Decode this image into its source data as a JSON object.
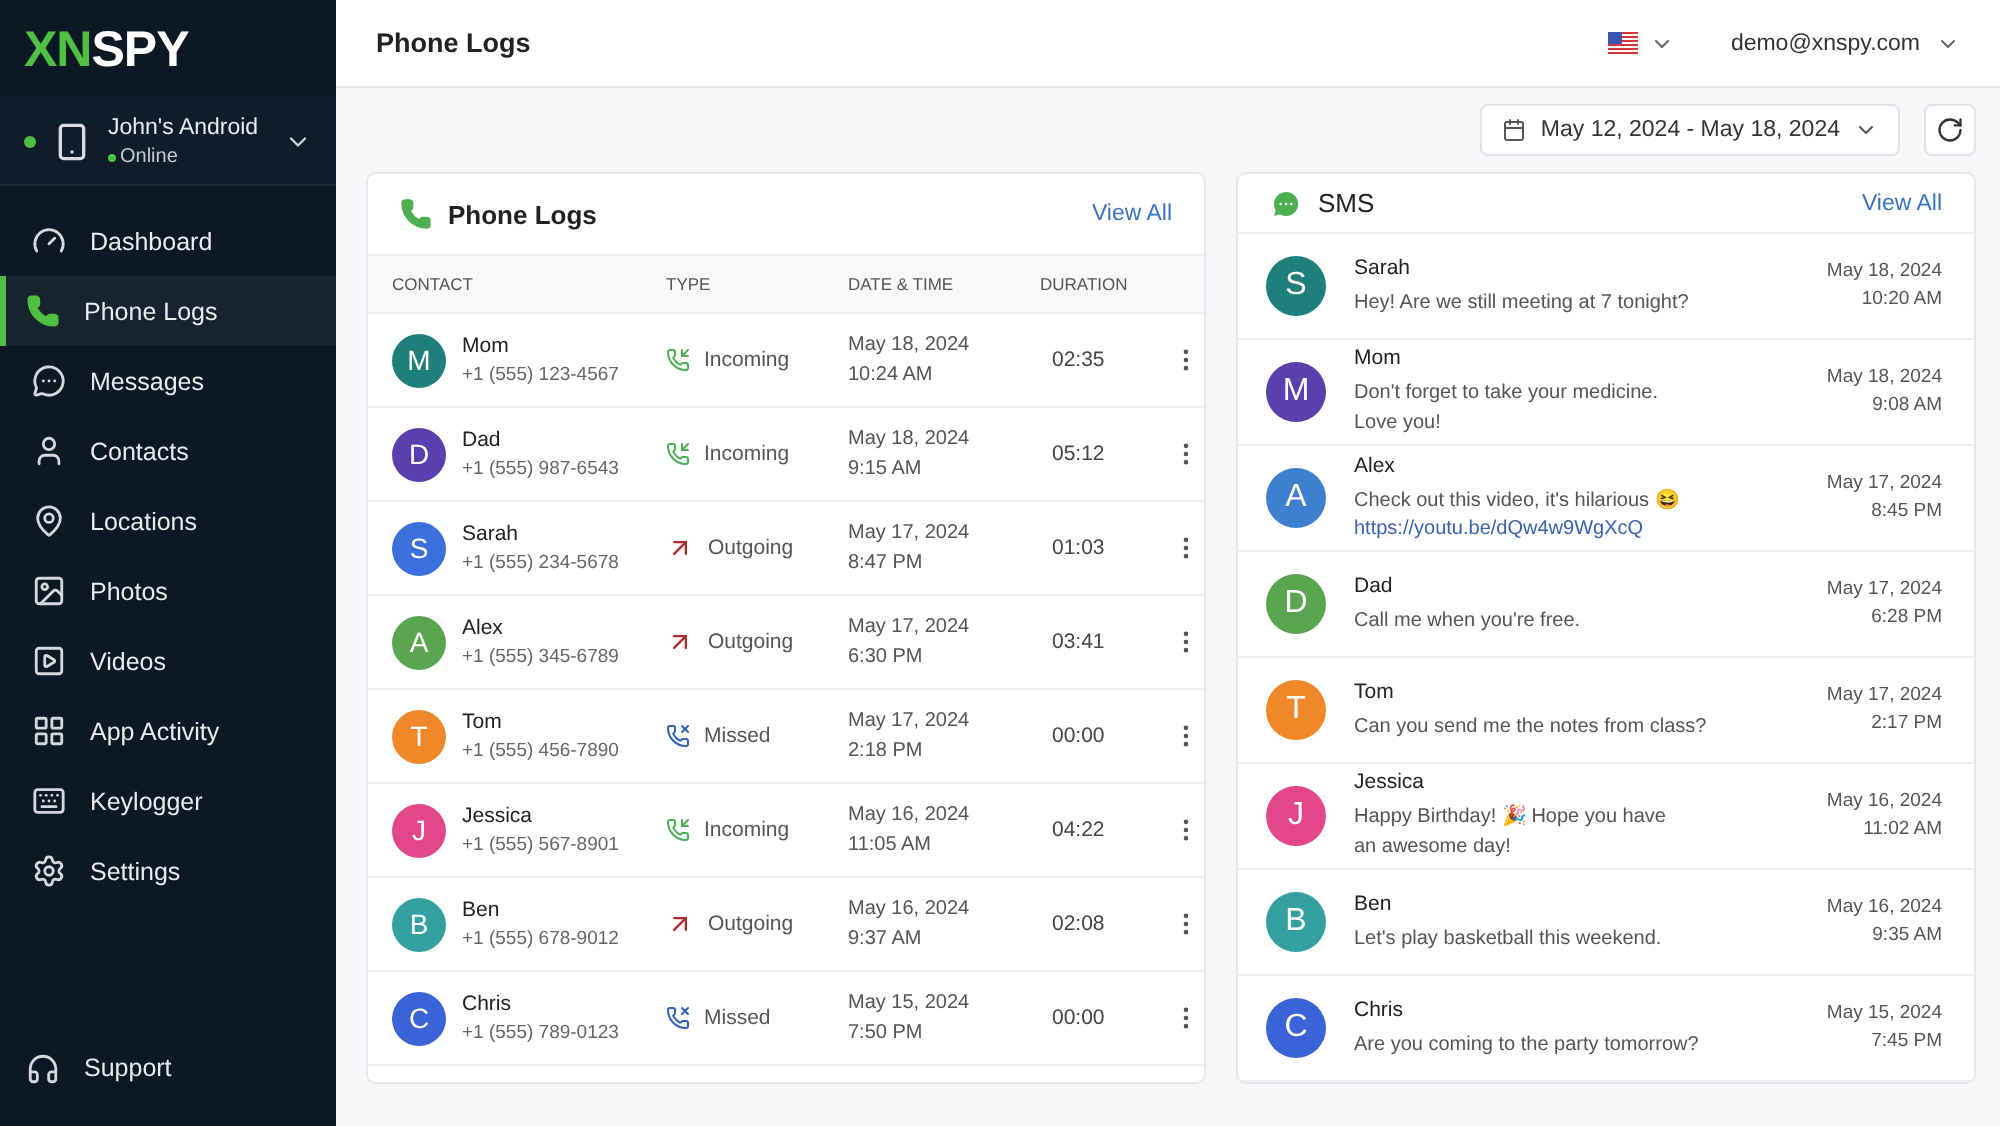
{
  "logo": {
    "accent": "XN",
    "rest": "SPY"
  },
  "device": {
    "name": "John's Android",
    "status": "Online",
    "online": true
  },
  "sidebar": {
    "items": [
      {
        "label": "Dashboard",
        "selected": false
      },
      {
        "label": "Phone Logs",
        "selected": true
      },
      {
        "label": "Messages",
        "selected": false
      },
      {
        "label": "Contacts",
        "selected": false
      },
      {
        "label": "Locations",
        "selected": false
      },
      {
        "label": "Photos",
        "selected": false
      },
      {
        "label": "Videos",
        "selected": false
      },
      {
        "label": "App Activity",
        "selected": false
      },
      {
        "label": "Keylogger",
        "selected": false
      },
      {
        "label": "Settings",
        "selected": false
      }
    ],
    "support": "Support"
  },
  "header": {
    "title": "Phone Logs",
    "account": "demo@xnspy.com"
  },
  "date_range": "May 12, 2024 - May 18, 2024",
  "phone_logs": {
    "title": "Phone Logs",
    "view_all": "View All",
    "columns": [
      "CONTACT",
      "TYPE",
      "DATE & TIME",
      "DURATION"
    ],
    "rows": [
      {
        "initial": "M",
        "color": "#1f7f7a",
        "name": "Mom",
        "phone": "+1 (555) 123-4567",
        "kind": "incoming",
        "type": "Incoming",
        "date": "May 18, 2024",
        "time": "10:24 AM",
        "duration": "02:35"
      },
      {
        "initial": "D",
        "color": "#5b3fae",
        "name": "Dad",
        "phone": "+1 (555) 987-6543",
        "kind": "incoming",
        "type": "Incoming",
        "date": "May 18, 2024",
        "time": "9:15 AM",
        "duration": "05:12"
      },
      {
        "initial": "S",
        "color": "#3a6fdc",
        "name": "Sarah",
        "phone": "+1 (555) 234-5678",
        "kind": "outgoing",
        "type": "Outgoing",
        "date": "May 17, 2024",
        "time": "8:47 PM",
        "duration": "01:03"
      },
      {
        "initial": "A",
        "color": "#5aa650",
        "name": "Alex",
        "phone": "+1 (555) 345-6789",
        "kind": "outgoing",
        "type": "Outgoing",
        "date": "May 17, 2024",
        "time": "6:30 PM",
        "duration": "03:41"
      },
      {
        "initial": "T",
        "color": "#f0882a",
        "name": "Tom",
        "phone": "+1 (555) 456-7890",
        "kind": "missed",
        "type": "Missed",
        "date": "May 17, 2024",
        "time": "2:18 PM",
        "duration": "00:00"
      },
      {
        "initial": "J",
        "color": "#e2478a",
        "name": "Jessica",
        "phone": "+1 (555) 567-8901",
        "kind": "incoming",
        "type": "Incoming",
        "date": "May 16, 2024",
        "time": "11:05 AM",
        "duration": "04:22"
      },
      {
        "initial": "B",
        "color": "#35a0a0",
        "name": "Ben",
        "phone": "+1 (555) 678-9012",
        "kind": "outgoing",
        "type": "Outgoing",
        "date": "May 16, 2024",
        "time": "9:37 AM",
        "duration": "02:08"
      },
      {
        "initial": "C",
        "color": "#3a63d8",
        "name": "Chris",
        "phone": "+1 (555) 789-0123",
        "kind": "missed",
        "type": "Missed",
        "date": "May 15, 2024",
        "time": "7:50 PM",
        "duration": "00:00"
      }
    ]
  },
  "sms": {
    "title": "SMS",
    "view_all": "View All",
    "rows": [
      {
        "initial": "S",
        "color": "#1f7f7a",
        "name": "Sarah",
        "message": "Hey! Are we still meeting at 7 tonight?",
        "date": "May 18, 2024",
        "time": "10:20 AM"
      },
      {
        "initial": "M",
        "color": "#5b3fae",
        "name": "Mom",
        "message": "Don't forget to take your medicine.\nLove you!",
        "date": "May 18, 2024",
        "time": "9:08 AM"
      },
      {
        "initial": "A",
        "color": "#3f7fd0",
        "name": "Alex",
        "message": "Check out this video, it's hilarious 😆",
        "link": "https://youtu.be/dQw4w9WgXcQ",
        "date": "May 17, 2024",
        "time": "8:45 PM"
      },
      {
        "initial": "D",
        "color": "#5aa650",
        "name": "Dad",
        "message": "Call me when you're free.",
        "date": "May 17, 2024",
        "time": "6:28 PM"
      },
      {
        "initial": "T",
        "color": "#f0882a",
        "name": "Tom",
        "message": "Can you send me the notes from class?",
        "date": "May 17, 2024",
        "time": "2:17 PM"
      },
      {
        "initial": "J",
        "color": "#e2478a",
        "name": "Jessica",
        "message": "Happy Birthday! 🎉 Hope you have\nan awesome day!",
        "date": "May 16, 2024",
        "time": "11:02 AM"
      },
      {
        "initial": "B",
        "color": "#35a0a0",
        "name": "Ben",
        "message": "Let's play basketball this weekend.",
        "date": "May 16, 2024",
        "time": "9:35 AM"
      },
      {
        "initial": "C",
        "color": "#3a63d8",
        "name": "Chris",
        "message": "Are you coming to the party tomorrow?",
        "date": "May 15, 2024",
        "time": "7:45 PM"
      }
    ]
  }
}
